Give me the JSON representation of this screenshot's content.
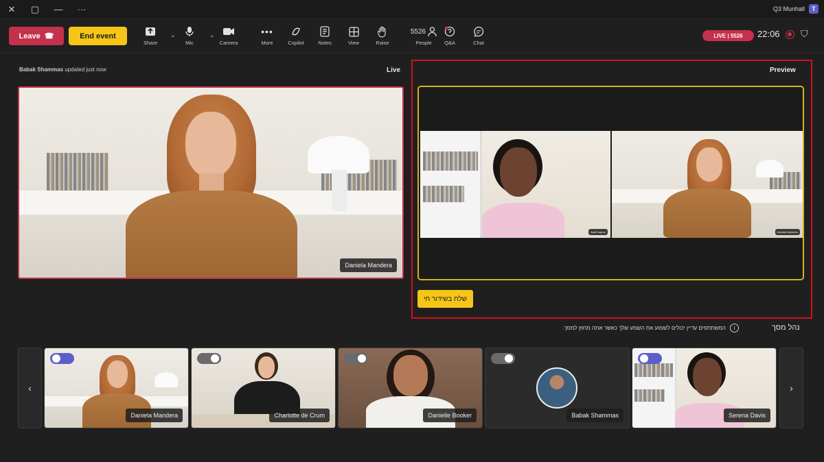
{
  "titlebar": {
    "more": "···",
    "meeting_name": "Q3 Munhall",
    "logo": "T"
  },
  "toolbar": {
    "leave_label": "Leave",
    "end_event_label": "End event",
    "tools": {
      "share": "Share",
      "mic": "Mic",
      "camera": "Camera",
      "more": "More",
      "copilot": "Copilot",
      "notes": "Notes",
      "view": "View",
      "raise": "Raise",
      "people": "People",
      "people_count": "5526",
      "qa": "Q&A",
      "chat": "Chat"
    },
    "live_badge": "LIVE | 5526",
    "timer": "22:06"
  },
  "stage": {
    "live_label": "Live",
    "updated_name": "Babak Shammas",
    "updated_suffix": "updated just now",
    "live_name": "Daniela Mandera",
    "preview_label": "Preview",
    "preview_tiles": [
      "Aadi Kapoor",
      "Daniela Mandera"
    ],
    "send_live_label": "שלח בשידור חי"
  },
  "manage": {
    "title": "נהל מסך",
    "info_text": "המשתתפים עדיין יכולים לשמוע את השמע שלך כאשר אתה מחוץ למסך."
  },
  "participants": [
    {
      "name": "Daniela Mandera",
      "toggle": "on"
    },
    {
      "name": "Charlotte de Crum",
      "toggle": "off"
    },
    {
      "name": "Danielle Booker",
      "toggle": "off"
    },
    {
      "name": "Babak Shammas",
      "toggle": "off"
    },
    {
      "name": "Serena Davis",
      "toggle": "on"
    }
  ],
  "colors": {
    "accent": "#5b5fc7",
    "live_red": "#c4314b",
    "highlight_yellow": "#f5c518",
    "annotation_red": "#d1111c"
  }
}
